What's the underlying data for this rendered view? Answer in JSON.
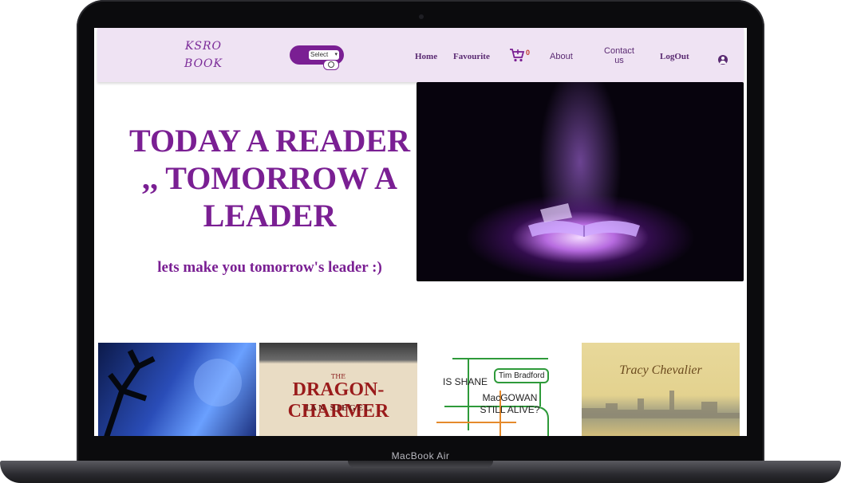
{
  "device": {
    "label": "MacBook Air"
  },
  "navbar": {
    "logo_line1": "KSRO",
    "logo_line2": "BOOK",
    "select_value": "Select",
    "links": {
      "home": "Home",
      "favourite": "Favourite",
      "cart_count": "0",
      "about": "About",
      "contact": "Contact us",
      "logout": "LogOut"
    }
  },
  "hero": {
    "title_line1": "TODAY A READER",
    "title_line2": ",, TOMORROW A",
    "title_line3": "LEADER",
    "subtitle": "lets make you tomorrow's leader :)"
  },
  "books": [
    {
      "text": ""
    },
    {
      "small": "THE",
      "title": "DRAGON-CHARMER",
      "author": "JAN SIEGEL"
    },
    {
      "line1": "IS SHANE",
      "author": "Tim Bradford",
      "line2": "MacGOWAN STILL ALIVE?"
    },
    {
      "author": "Tracy Chevalier"
    }
  ],
  "colors": {
    "accent": "#7a1f93",
    "navbar_bg": "#efe3f3",
    "cart_badge": "#c0392b"
  },
  "icons": [
    "cart-icon",
    "search-icon",
    "user-circle-icon",
    "chevron-down-icon"
  ]
}
